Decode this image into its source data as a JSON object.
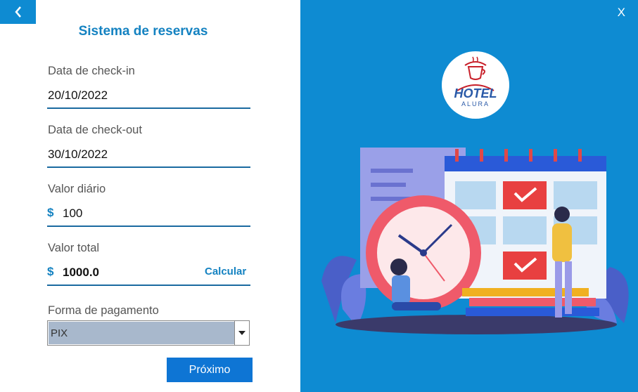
{
  "back_icon": "chevron-left-icon",
  "title": "Sistema de reservas",
  "checkin": {
    "label": "Data de check-in",
    "value": "20/10/2022"
  },
  "checkout": {
    "label": "Data de check-out",
    "value": "30/10/2022"
  },
  "daily": {
    "label": "Valor diário",
    "currency": "$",
    "value": "100"
  },
  "total": {
    "label": "Valor total",
    "currency": "$",
    "value": "1000.0",
    "calc_label": "Calcular"
  },
  "payment": {
    "label": "Forma de pagamento",
    "selected": "PIX"
  },
  "next_label": "Próximo",
  "close_label": "X",
  "logo": {
    "line1": "HOTEL",
    "line2": "ALURA"
  },
  "colors": {
    "accent": "#0e8bd2",
    "title": "#1482c1",
    "button": "#0e75d4",
    "select_bg": "#a8b8cc"
  }
}
